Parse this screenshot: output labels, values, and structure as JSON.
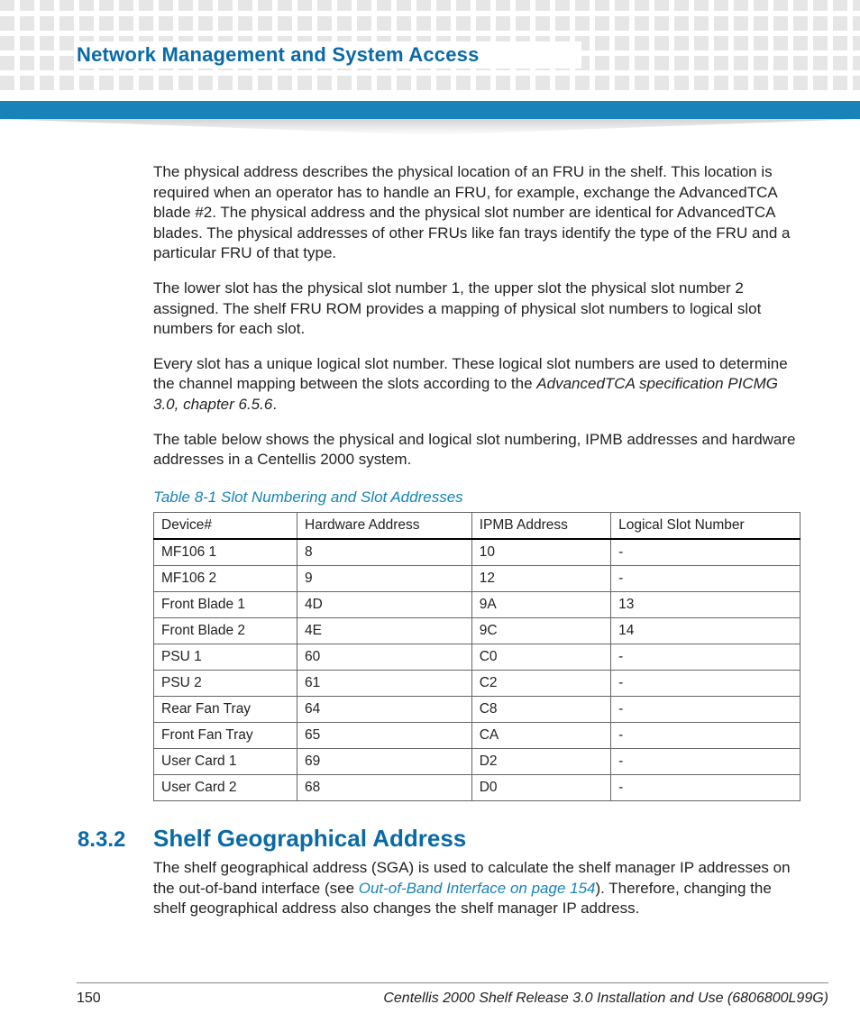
{
  "header": {
    "chapter_title": "Network Management and System Access"
  },
  "body": {
    "p1": "The physical address describes the physical location of an FRU in the shelf. This location is required when an operator has to handle an FRU, for example, exchange the AdvancedTCA blade #2. The physical address and the physical slot number are identical for AdvancedTCA blades. The physical addresses of other FRUs like fan trays identify the type of the FRU and a particular FRU of that type.",
    "p2": "The lower slot has the physical slot number 1, the upper slot the physical slot number 2 assigned. The shelf FRU ROM provides a mapping of physical slot numbers to logical slot numbers for each slot.",
    "p3a": "Every slot has a unique logical slot number. These logical slot numbers are used to determine the channel mapping between the slots according to the ",
    "p3_italic": "AdvancedTCA specification PICMG 3.0, chapter 6.5.6",
    "p3b": ".",
    "p4": "The table below shows the physical and logical slot numbering, IPMB addresses and hardware addresses in a Centellis 2000 system."
  },
  "table": {
    "caption": "Table 8-1 Slot Numbering and Slot Addresses",
    "headers": [
      "Device#",
      "Hardware Address",
      "IPMB Address",
      "Logical Slot Number"
    ],
    "rows": [
      [
        "MF106 1",
        "8",
        "10",
        "-"
      ],
      [
        "MF106 2",
        "9",
        "12",
        "-"
      ],
      [
        "Front Blade 1",
        "4D",
        "9A",
        "13"
      ],
      [
        "Front Blade 2",
        "4E",
        "9C",
        "14"
      ],
      [
        "PSU 1",
        "60",
        "C0",
        "-"
      ],
      [
        "PSU 2",
        "61",
        "C2",
        "-"
      ],
      [
        "Rear Fan Tray",
        "64",
        "C8",
        "-"
      ],
      [
        "Front Fan Tray",
        "65",
        "CA",
        "-"
      ],
      [
        "User Card 1",
        "69",
        "D2",
        "-"
      ],
      [
        "User Card 2",
        "68",
        "D0",
        "-"
      ]
    ]
  },
  "section": {
    "number": "8.3.2",
    "title": "Shelf Geographical Address",
    "p1a": "The shelf geographical address (SGA) is used to calculate the shelf manager IP addresses on the out-of-band interface (see ",
    "p1_link": "Out-of-Band Interface on page 154",
    "p1b": "). Therefore, changing the shelf geographical address also changes the shelf manager IP address."
  },
  "footer": {
    "page_number": "150",
    "doc_ref": "Centellis 2000 Shelf Release 3.0 Installation and Use (6806800L99G)"
  }
}
